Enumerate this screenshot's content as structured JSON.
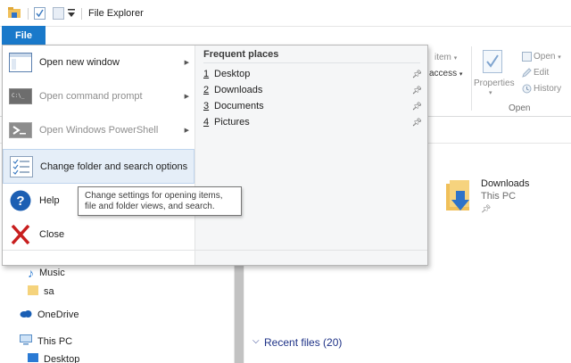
{
  "titlebar": {
    "title": "File Explorer"
  },
  "ribbon": {
    "item_label_partial": "item",
    "access_label_partial": "access",
    "properties_label": "Properties",
    "open_label": "Open",
    "edit_label": "Edit",
    "history_label": "History",
    "open_group_label": "Open"
  },
  "file_menu": {
    "tab_label": "File",
    "items": [
      {
        "label": "Open new window"
      },
      {
        "label": "Open command prompt"
      },
      {
        "label": "Open Windows PowerShell"
      },
      {
        "label": "Change folder and search options"
      },
      {
        "label": "Help"
      },
      {
        "label": "Close"
      }
    ],
    "frequent_places": {
      "title": "Frequent places",
      "items": [
        {
          "num": "1",
          "name": "Desktop"
        },
        {
          "num": "2",
          "name": "Downloads"
        },
        {
          "num": "3",
          "name": "Documents"
        },
        {
          "num": "4",
          "name": "Pictures"
        }
      ]
    },
    "tooltip": "Change settings for opening items, file and folder views, and search."
  },
  "nav": {
    "items": [
      {
        "label": "Music"
      },
      {
        "label": "sa"
      },
      {
        "label": "OneDrive"
      },
      {
        "label": "This PC"
      },
      {
        "label": "Desktop"
      }
    ]
  },
  "content": {
    "downloads_name": "Downloads",
    "downloads_location": "This PC",
    "recent_files_title": "Recent files (20)"
  },
  "colors": {
    "accent": "#1979ca",
    "folder": "#f0c05a",
    "close_red": "#c81e1e"
  }
}
